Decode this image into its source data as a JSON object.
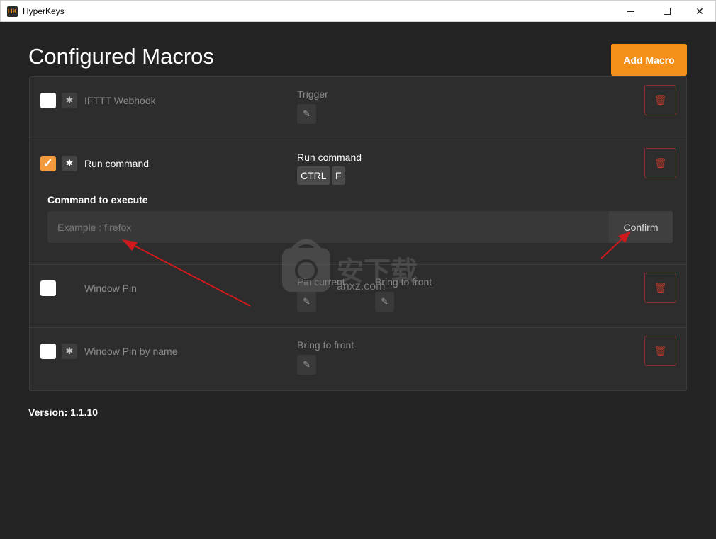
{
  "window": {
    "title": "HyperKeys",
    "icon_text": "HK"
  },
  "header": {
    "title": "Configured Macros",
    "add_button": "Add Macro"
  },
  "macros": [
    {
      "name": "IFTTT Webhook",
      "enabled": false,
      "trigger_label": "Trigger"
    },
    {
      "name": "Run command",
      "enabled": true,
      "trigger_label": "Run command",
      "keys": [
        "CTRL",
        "F"
      ],
      "command_label": "Command to execute",
      "command_placeholder": "Example : firefox",
      "confirm_label": "Confirm"
    },
    {
      "name": "Window Pin",
      "enabled": false,
      "trigger_label": "Pin current",
      "trigger_label_2": "Bring to front"
    },
    {
      "name": "Window Pin by name",
      "enabled": false,
      "trigger_label": "Bring to front"
    }
  ],
  "footer": {
    "version": "Version: 1.1.10"
  },
  "watermark": {
    "text": "anxz.com"
  },
  "colors": {
    "accent": "#f39019",
    "delete": "#c0392b",
    "background": "#232323",
    "arrow": "#d0191c"
  }
}
